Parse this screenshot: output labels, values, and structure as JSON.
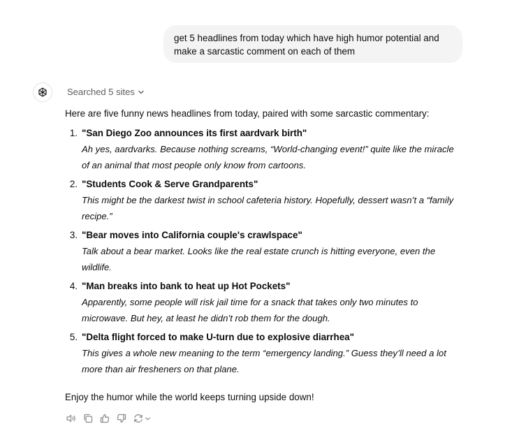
{
  "user_message": {
    "line1": "get 5 headlines from today which have high humor potential and",
    "line2": "make a sarcastic comment on each of them"
  },
  "assistant": {
    "searched_label": "Searched 5 sites",
    "intro": "Here are five funny news headlines from today, paired with some sarcastic commentary:",
    "items": [
      {
        "number": "1.",
        "headline": "\"San Diego Zoo announces its first aardvark birth\"",
        "comment_line1": "Ah yes, aardvarks. Because nothing screams, “World-changing event!” quite like the miracle",
        "comment_line2": "of an animal that most people only know from cartoons."
      },
      {
        "number": "2.",
        "headline": "\"Students Cook & Serve Grandparents\"",
        "comment_line1": "This might be the darkest twist in school cafeteria history. Hopefully, dessert wasn’t a “family",
        "comment_line2": "recipe.”"
      },
      {
        "number": "3.",
        "headline": "\"Bear moves into California couple's crawlspace\"",
        "comment_line1": "Talk about a bear market. Looks like the real estate crunch is hitting everyone, even the",
        "comment_line2": "wildlife."
      },
      {
        "number": "4.",
        "headline": "\"Man breaks into bank to heat up Hot Pockets\"",
        "comment_line1": "Apparently, some people will risk jail time for a snack that takes only two minutes to",
        "comment_line2": "microwave. But hey, at least he didn’t rob them for the dough."
      },
      {
        "number": "5.",
        "headline": "\"Delta flight forced to make U-turn due to explosive diarrhea\"",
        "comment_line1": "This gives a whole new meaning to the term “emergency landing.” Guess they’ll need a lot",
        "comment_line2": "more than air fresheners on that plane."
      }
    ],
    "outro": "Enjoy the humor while the world keeps turning upside down!"
  },
  "action_icons": [
    "read-aloud-icon",
    "copy-icon",
    "thumbs-up-icon",
    "thumbs-down-icon",
    "regenerate-icon",
    "chevron-down-icon"
  ],
  "colors": {
    "bubble_bg": "#f4f4f4",
    "text": "#0d0d0d",
    "muted": "#5d5d5d",
    "icon": "#8f8f8f"
  }
}
